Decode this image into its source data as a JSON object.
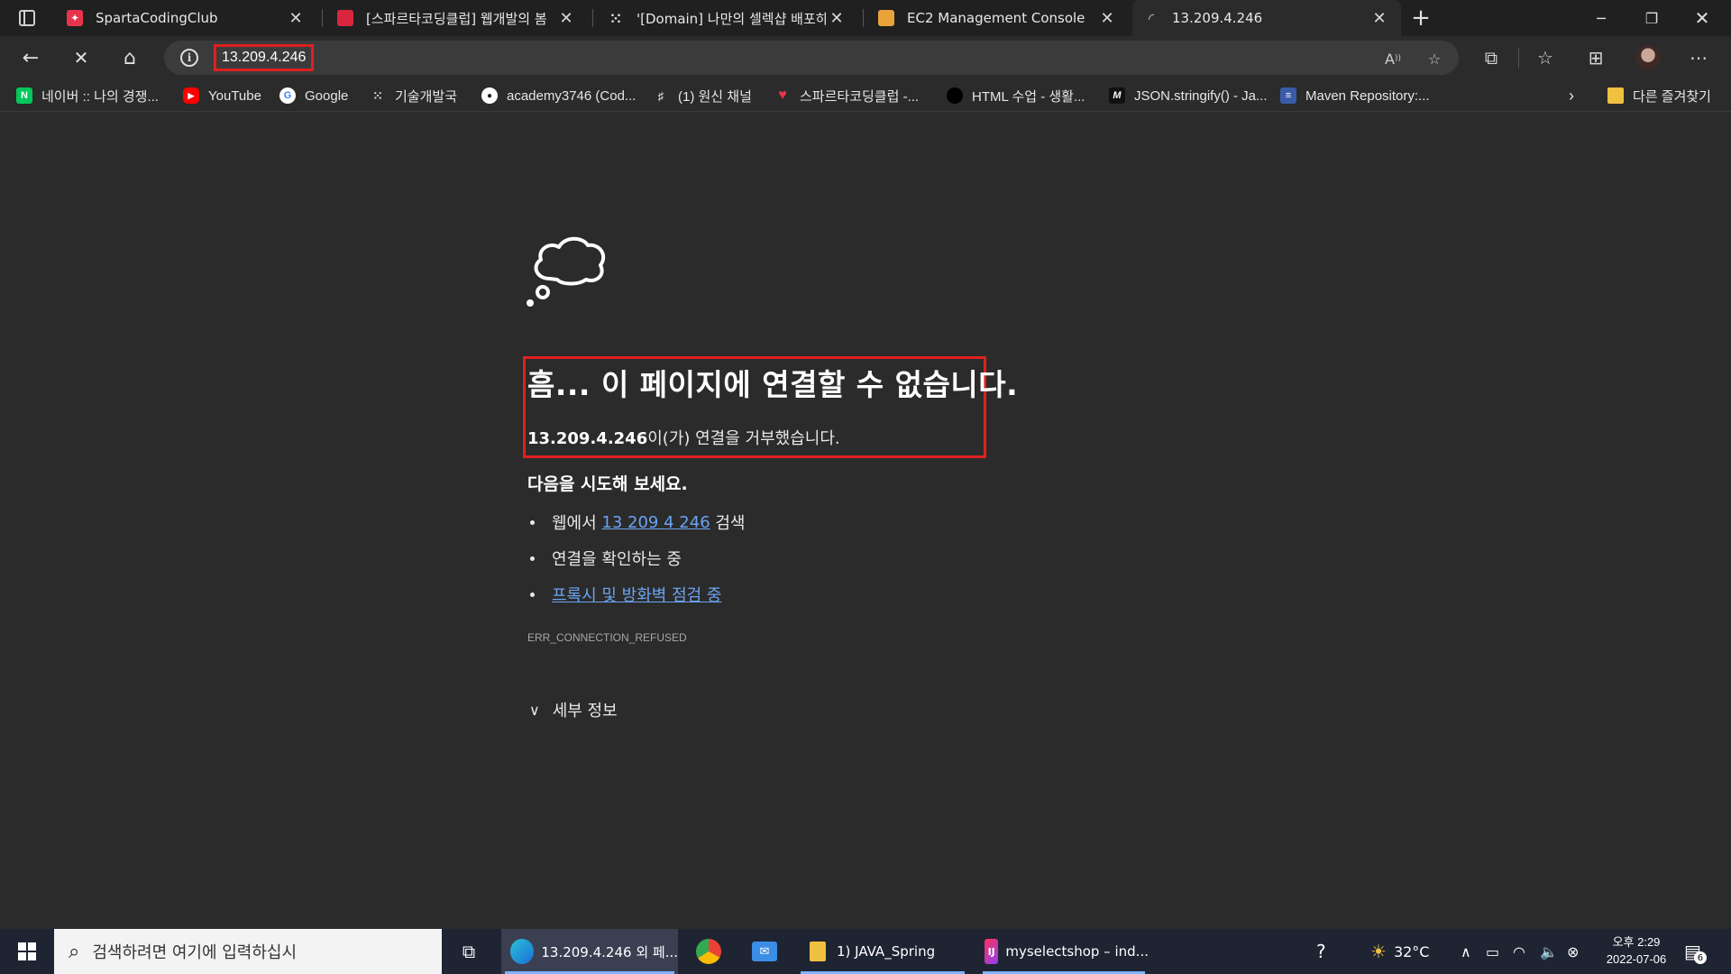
{
  "tabs": [
    {
      "title": "SpartaCodingClub",
      "icon": "sparta-favicon",
      "color": "#e8344a"
    },
    {
      "title": "[스파르타코딩클럽] 웹개발의 봄",
      "icon": "book-favicon",
      "color": "#d9263c"
    },
    {
      "title": "'[Domain] 나만의 셀렉샵 배포하",
      "icon": "notion-dots-favicon",
      "color": "#444444"
    },
    {
      "title": "EC2 Management Console",
      "icon": "aws-box-favicon",
      "color": "#e8a33a"
    },
    {
      "title": "13.209.4.246",
      "icon": "loading-spinner-icon",
      "color": "#bbbbbb"
    }
  ],
  "address_bar": {
    "url": "13.209.4.246"
  },
  "bookmarks": [
    {
      "label": "네이버 :: 나의 경쟁...",
      "icon": "naver-icon",
      "color": "#03c75a",
      "glyph": "N"
    },
    {
      "label": "YouTube",
      "icon": "youtube-icon",
      "color": "#ff0000",
      "glyph": "▶"
    },
    {
      "label": "Google",
      "icon": "google-icon",
      "color": "#ffffff",
      "glyph": "G"
    },
    {
      "label": "기술개발국",
      "icon": "dots-icon",
      "color": "#2b2b2b",
      "glyph": "⁚"
    },
    {
      "label": "academy3746 (Cod...",
      "icon": "github-icon",
      "color": "#2b2b2b",
      "glyph": "●"
    },
    {
      "label": "(1) 원신 채널",
      "icon": "channel-icon",
      "color": "#2b2b2b",
      "glyph": "♯"
    },
    {
      "label": "스파르타코딩클럽 -...",
      "icon": "sparta-heart-icon",
      "color": "#e8344a",
      "glyph": "♥"
    },
    {
      "label": "HTML 수업 - 생활...",
      "icon": "black-circle-icon",
      "color": "#000000",
      "glyph": ""
    },
    {
      "label": "JSON.stringify() - Ja...",
      "icon": "mdn-icon",
      "color": "#111111",
      "glyph": "M"
    },
    {
      "label": "Maven Repository:...",
      "icon": "maven-icon",
      "color": "#3a5ca8",
      "glyph": "≡"
    }
  ],
  "other_favorites": "다른 즐겨찾기",
  "error_page": {
    "title": "흠... 이 페이지에 연결할 수 없습니다.",
    "host": "13.209.4.246",
    "desc_suffix": "이(가) 연결을 거부했습니다.",
    "try_heading": "다음을 시도해 보세요.",
    "suggestions": {
      "web_search_prefix": "웹에서 ",
      "web_search_link": "13 209 4 246",
      "web_search_suffix": " 검색",
      "check_connection": "연결을 확인하는 중",
      "proxy_firewall": "프록시 및 방화벽 점검 중"
    },
    "error_code": "ERR_CONNECTION_REFUSED",
    "details": "세부 정보"
  },
  "taskbar": {
    "search_placeholder": "검색하려면 여기에 입력하십시",
    "apps": [
      {
        "label": "13.209.4.246 외 페...",
        "icon": "edge-icon"
      },
      {
        "label": "",
        "icon": "chrome-icon"
      },
      {
        "label": "",
        "icon": "mail-icon"
      },
      {
        "label": "1) JAVA_Spring",
        "icon": "folder-icon"
      },
      {
        "label": "myselectshop – ind...",
        "icon": "intellij-icon"
      }
    ],
    "weather": "32°C",
    "time": "오후 2:29",
    "date": "2022-07-06",
    "notifications": "6"
  }
}
